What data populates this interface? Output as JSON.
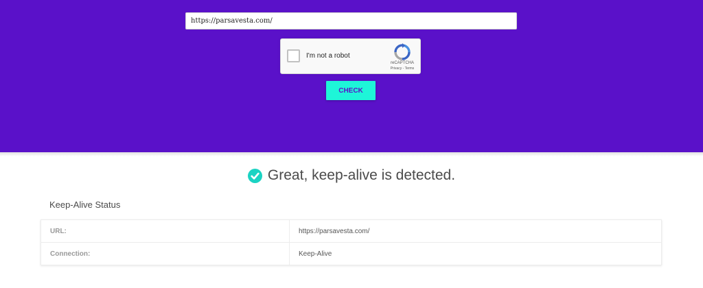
{
  "form": {
    "url_value": "https://parsavesta.com/",
    "check_label": "CHECK"
  },
  "recaptcha": {
    "label": "I'm not a robot",
    "brand": "reCAPTCHA",
    "privacy_label": "Privacy",
    "separator": " - ",
    "terms_label": "Terms"
  },
  "result": {
    "message": "Great, keep-alive is detected."
  },
  "status": {
    "title": "Keep-Alive Status",
    "rows": [
      {
        "label": "URL:",
        "value": "https://parsavesta.com/"
      },
      {
        "label": "Connection:",
        "value": "Keep-Alive"
      }
    ]
  },
  "colors": {
    "hero_bg": "#5a11c9",
    "accent": "#1ef5d8"
  },
  "icons": {
    "result": "check-circle-icon",
    "recaptcha": "recaptcha-logo-icon"
  }
}
